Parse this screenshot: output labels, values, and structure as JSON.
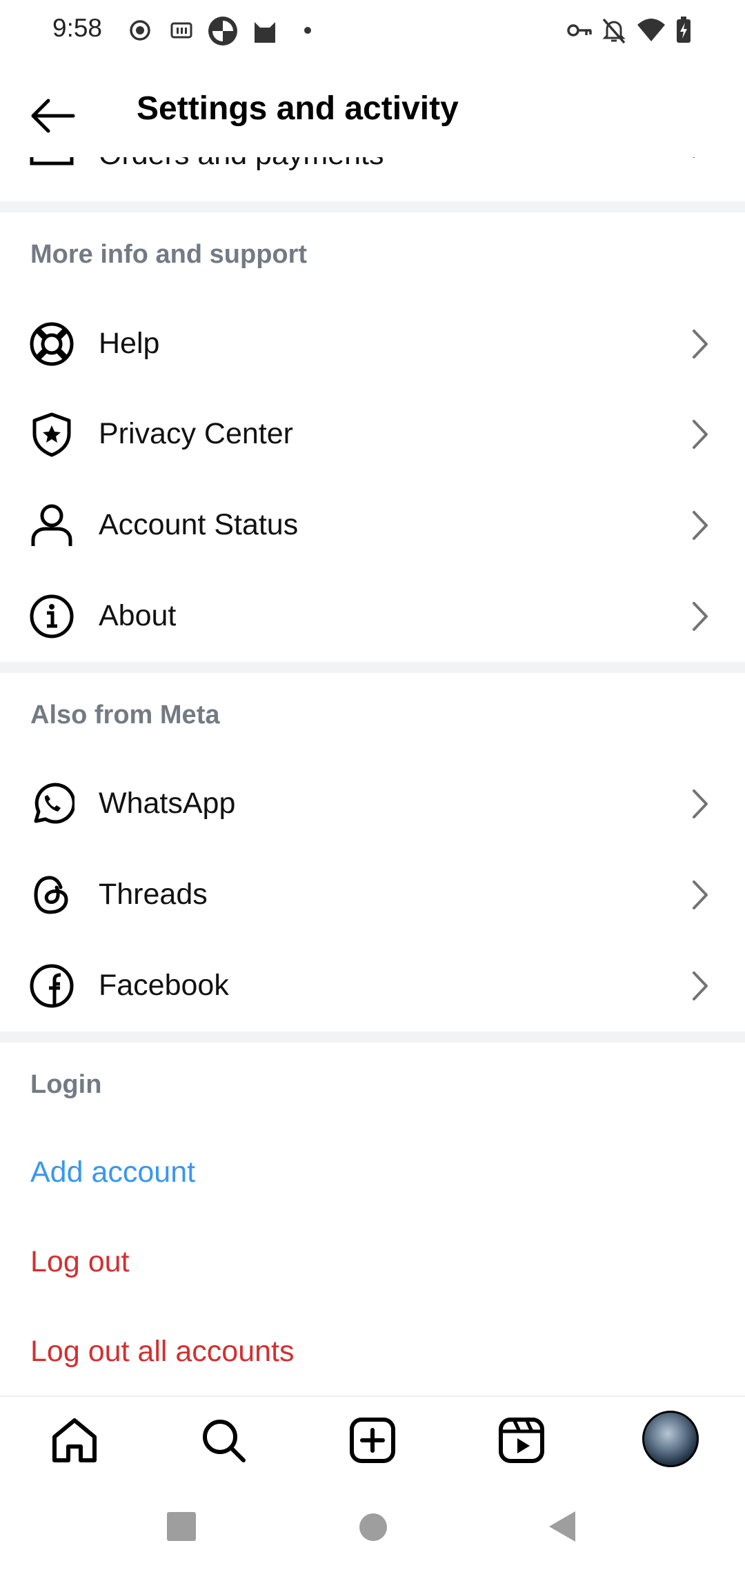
{
  "status_bar": {
    "time": "9:58",
    "left_icons": [
      "record-icon",
      "iqiyi-icon",
      "app-icon",
      "cat-icon",
      "dot-icon"
    ],
    "right_icons": [
      "key-icon",
      "bell-off-icon",
      "wifi-icon",
      "battery-charging-icon"
    ]
  },
  "header": {
    "title": "Settings and activity",
    "back_icon": "arrow-left-icon"
  },
  "partial_row": {
    "label": "Orders and payments"
  },
  "sections": {
    "more_info": {
      "title": "More info and support",
      "items": [
        {
          "label": "Help",
          "icon": "lifebuoy-icon"
        },
        {
          "label": "Privacy Center",
          "icon": "shield-star-icon"
        },
        {
          "label": "Account Status",
          "icon": "person-icon"
        },
        {
          "label": "About",
          "icon": "info-icon"
        }
      ]
    },
    "meta": {
      "title": "Also from Meta",
      "items": [
        {
          "label": "WhatsApp",
          "icon": "whatsapp-icon"
        },
        {
          "label": "Threads",
          "icon": "threads-icon"
        },
        {
          "label": "Facebook",
          "icon": "facebook-icon"
        }
      ]
    },
    "login": {
      "title": "Login",
      "add_account": "Add account",
      "log_out": "Log out",
      "log_out_all": "Log out all accounts"
    }
  },
  "bottom_nav": [
    "home-icon",
    "search-icon",
    "create-icon",
    "reels-icon",
    "profile-avatar"
  ],
  "system_nav": [
    "recents-button",
    "home-button",
    "back-button"
  ],
  "colors": {
    "link_blue": "#3797f0",
    "danger_red": "#d32f2f",
    "section_gray": "#737a84",
    "divider": "#f2f3f5"
  }
}
